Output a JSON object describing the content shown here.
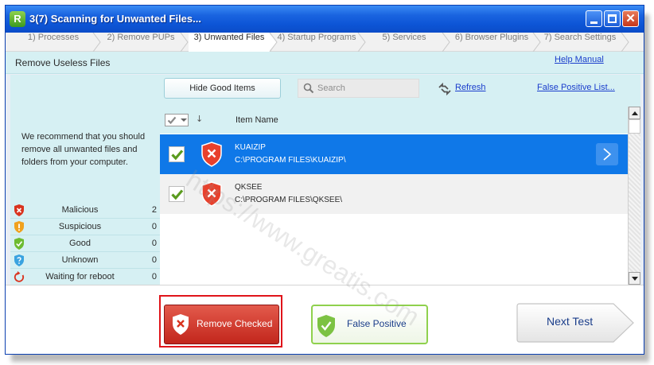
{
  "window": {
    "title": "3(7) Scanning for Unwanted Files...",
    "app_icon_letter": "R",
    "close_glyph": "✕"
  },
  "steps": [
    {
      "label": "1) Processes",
      "active": false
    },
    {
      "label": "2) Remove PUPs",
      "active": false
    },
    {
      "label": "3) Unwanted Files",
      "active": true
    },
    {
      "label": "4) Startup Programs",
      "active": false
    },
    {
      "label": "5) Services",
      "active": false
    },
    {
      "label": "6) Browser Plugins",
      "active": false
    },
    {
      "label": "7) Search Settings",
      "active": false
    }
  ],
  "header": {
    "section_title": "Remove Useless Files",
    "help_link": "Help Manual"
  },
  "left": {
    "recommendation": "We recommend that you should remove all unwanted files and folders from your computer.",
    "stats": [
      {
        "label": "Malicious",
        "count": "2",
        "icon": "shield-x-icon",
        "color": "#d9331e"
      },
      {
        "label": "Suspicious",
        "count": "0",
        "icon": "shield-exclamation-icon",
        "color": "#f0a11d"
      },
      {
        "label": "Good",
        "count": "0",
        "icon": "shield-check-icon",
        "color": "#6cbb30"
      },
      {
        "label": "Unknown",
        "count": "0",
        "icon": "shield-question-icon",
        "color": "#3aa3e0"
      },
      {
        "label": "Waiting for reboot",
        "count": "0",
        "icon": "reboot-icon",
        "color": "#d9331e"
      }
    ]
  },
  "toolbar": {
    "hide_good_label": "Hide Good Items",
    "search_placeholder": "Search",
    "refresh_label": "Refresh",
    "false_positive_list_label": "False Positive List..."
  },
  "list": {
    "sort_glyph": "↓",
    "column_name": "Item Name",
    "items": [
      {
        "name": "KUAIZIP",
        "path": "C:\\PROGRAM FILES\\KUAIZIP\\",
        "checked": true,
        "selected": true
      },
      {
        "name": "QKSEE",
        "path": "C:\\PROGRAM FILES\\QKSEE\\",
        "checked": true,
        "selected": false
      }
    ]
  },
  "footer": {
    "remove_label": "Remove Checked",
    "false_positive_label": "False Positive",
    "next_label": "Next Test"
  },
  "watermark": "https://www.greatis.com",
  "colors": {
    "accent": "#0f78e8",
    "panel": "#d6f0f3",
    "malicious": "#d9331e",
    "good": "#6cbb30"
  }
}
